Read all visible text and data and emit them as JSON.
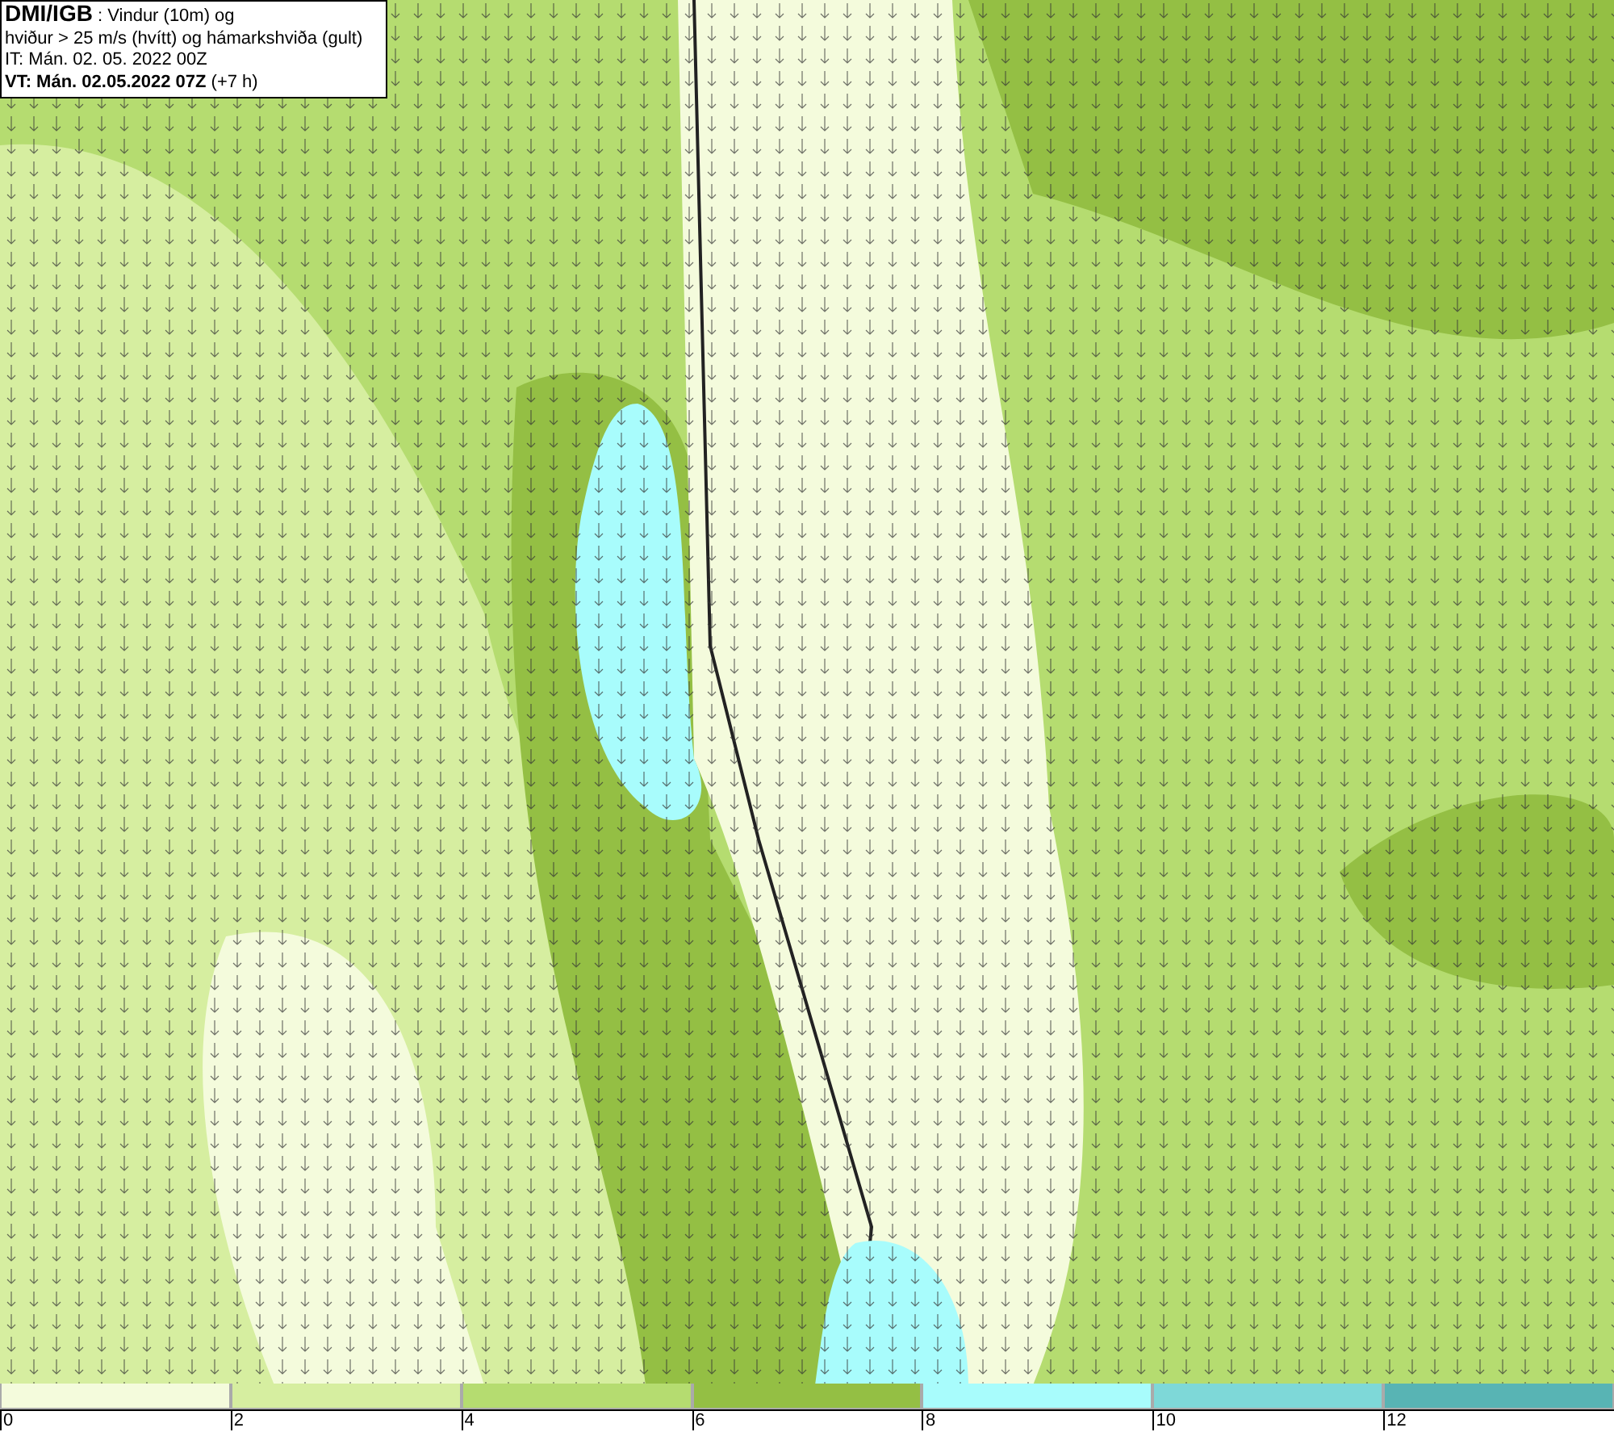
{
  "title_box": {
    "lines": [
      "**DMI/IGB** : Vindur (10m) og",
      "hviður > 25 m/s (hvítt) og hámarkshviða (gult)",
      "IT: Mán. 02. 05. 2022 00Z",
      "**VT: Mán. 02.05.2022 07Z** (+7 h)"
    ]
  },
  "legend": {
    "segments": [
      {
        "color": "#f4fbdc"
      },
      {
        "color": "#d6eea0"
      },
      {
        "color": "#b5dc70"
      },
      {
        "color": "#94bf44"
      },
      {
        "color": "#a8fcfc"
      },
      {
        "color": "#7ed8d8"
      },
      {
        "color": "#58b4b4"
      }
    ],
    "ticks": [
      "0",
      "2",
      "4",
      "6",
      "8",
      "10",
      "12"
    ]
  }
}
